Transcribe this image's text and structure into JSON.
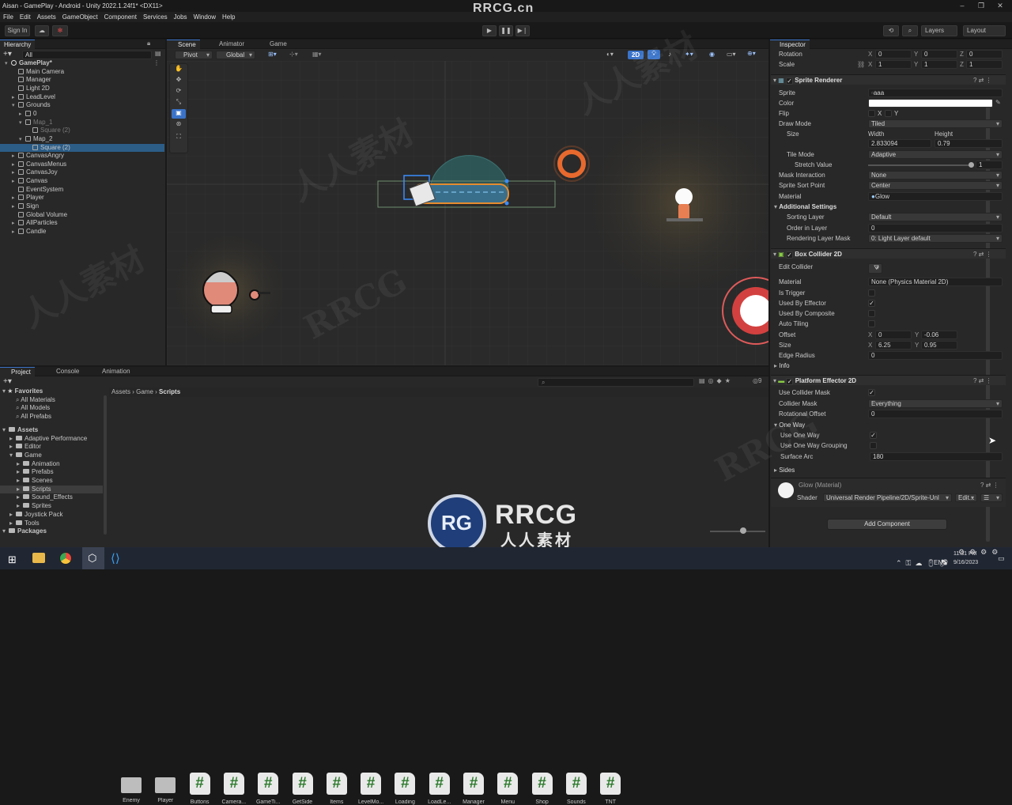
{
  "window": {
    "title": "Aisan - GamePlay - Android - Unity 2022.1.24f1* <DX11>",
    "watermark_top": "RRCG.cn"
  },
  "menu": [
    "File",
    "Edit",
    "Assets",
    "GameObject",
    "Component",
    "Services",
    "Jobs",
    "Window",
    "Help"
  ],
  "toolbar": {
    "sign_in": "Sign In",
    "layers": "Layers",
    "layout": "Layout"
  },
  "hierarchy": {
    "tab": "Hierarchy",
    "search": "All",
    "rows": [
      {
        "label": "GamePlay*",
        "indent": 0,
        "expanded": true,
        "scene": true
      },
      {
        "label": "Main Camera",
        "indent": 1
      },
      {
        "label": "Manager",
        "indent": 1
      },
      {
        "label": "Light 2D",
        "indent": 1
      },
      {
        "label": "LeadLevel",
        "indent": 1,
        "arrow": true
      },
      {
        "label": "Grounds",
        "indent": 1,
        "expanded": true
      },
      {
        "label": "0",
        "indent": 2,
        "arrow": true
      },
      {
        "label": "Map_1",
        "indent": 2,
        "expanded": true,
        "dim": true
      },
      {
        "label": "Square (2)",
        "indent": 3,
        "dim": true
      },
      {
        "label": "Map_2",
        "indent": 2,
        "expanded": true
      },
      {
        "label": "Square (2)",
        "indent": 3,
        "selected": true
      },
      {
        "label": "CanvasAngry",
        "indent": 1,
        "arrow": true
      },
      {
        "label": "CanvasMenus",
        "indent": 1,
        "arrow": true
      },
      {
        "label": "CanvasJoy",
        "indent": 1,
        "arrow": true
      },
      {
        "label": "Canvas",
        "indent": 1,
        "arrow": true
      },
      {
        "label": "EventSystem",
        "indent": 1
      },
      {
        "label": "Player",
        "indent": 1,
        "arrow": true
      },
      {
        "label": "Sign",
        "indent": 1,
        "arrow": true
      },
      {
        "label": "Global Volume",
        "indent": 1
      },
      {
        "label": "AllParticles",
        "indent": 1,
        "arrow": true
      },
      {
        "label": "Candle",
        "indent": 1,
        "arrow": true
      }
    ]
  },
  "scene": {
    "tabs": [
      "Scene",
      "Animator",
      "Game"
    ],
    "pivot": "Pivot",
    "global": "Global",
    "mode2d": "2D"
  },
  "project": {
    "tabs": [
      "Project",
      "Console",
      "Animation"
    ],
    "breadcrumb": [
      "Assets",
      "Game",
      "Scripts"
    ],
    "count": "9",
    "favorites": {
      "label": "Favorites",
      "items": [
        "All Materials",
        "All Models",
        "All Prefabs"
      ]
    },
    "tree": [
      {
        "label": "Assets",
        "indent": 0,
        "bold": true
      },
      {
        "label": "Adaptive Performance",
        "indent": 1
      },
      {
        "label": "Editor",
        "indent": 1
      },
      {
        "label": "Game",
        "indent": 1
      },
      {
        "label": "Animation",
        "indent": 2
      },
      {
        "label": "Prefabs",
        "indent": 2
      },
      {
        "label": "Scenes",
        "indent": 2
      },
      {
        "label": "Scripts",
        "indent": 2,
        "selected": true
      },
      {
        "label": "Sound_Effects",
        "indent": 2
      },
      {
        "label": "Sprites",
        "indent": 2
      },
      {
        "label": "Joystick Pack",
        "indent": 1
      },
      {
        "label": "Tools",
        "indent": 1
      },
      {
        "label": "Packages",
        "indent": 0,
        "bold": true
      }
    ],
    "assets": [
      {
        "name": "Enemy",
        "type": "folder"
      },
      {
        "name": "Player",
        "type": "folder"
      },
      {
        "name": "Buttons",
        "type": "script"
      },
      {
        "name": "Camera...",
        "type": "script"
      },
      {
        "name": "GameTi...",
        "type": "script"
      },
      {
        "name": "GetSide",
        "type": "script"
      },
      {
        "name": "Items",
        "type": "script"
      },
      {
        "name": "LevelMo...",
        "type": "script"
      },
      {
        "name": "Loading",
        "type": "script"
      },
      {
        "name": "LoadLe...",
        "type": "script"
      },
      {
        "name": "Manager",
        "type": "script"
      },
      {
        "name": "Menu",
        "type": "script"
      },
      {
        "name": "Shop",
        "type": "script"
      },
      {
        "name": "Sounds",
        "type": "script"
      },
      {
        "name": "TNT",
        "type": "script"
      }
    ]
  },
  "inspector": {
    "tab": "Inspector",
    "transform": {
      "rotation": {
        "label": "Rotation",
        "x": "0",
        "y": "0",
        "z": "0"
      },
      "scale": {
        "label": "Scale",
        "x": "1",
        "y": "1",
        "z": "1"
      }
    },
    "sprite_renderer": {
      "title": "Sprite Renderer",
      "sprite_label": "Sprite",
      "sprite": "aaa",
      "color_label": "Color",
      "flip_label": "Flip",
      "flip_x": "X",
      "flip_y": "Y",
      "draw_mode_label": "Draw Mode",
      "draw_mode": "Tiled",
      "size_label": "Size",
      "width_label": "Width",
      "height_label": "Height",
      "width": "2.833094",
      "height": "0.79",
      "tile_mode_label": "Tile Mode",
      "tile_mode": "Adaptive",
      "stretch_label": "Stretch Value",
      "stretch": "1",
      "mask_label": "Mask Interaction",
      "mask": "None",
      "sort_point_label": "Sprite Sort Point",
      "sort_point": "Center",
      "material_label": "Material",
      "material": "Glow",
      "additional": "Additional Settings",
      "sorting_layer_label": "Sorting Layer",
      "sorting_layer": "Default",
      "order_label": "Order in Layer",
      "order": "0",
      "rlm_label": "Rendering Layer Mask",
      "rlm": "0: Light Layer default"
    },
    "box_collider": {
      "title": "Box Collider 2D",
      "edit_label": "Edit Collider",
      "material_label": "Material",
      "material": "None (Physics Material 2D)",
      "is_trigger": "Is Trigger",
      "used_by_effector": "Used By Effector",
      "used_by_composite": "Used By Composite",
      "auto_tiling": "Auto Tiling",
      "offset_label": "Offset",
      "offset_x": "0",
      "offset_y": "-0.06",
      "size_label": "Size",
      "size_x": "6.25",
      "size_y": "0.95",
      "edge_label": "Edge Radius",
      "edge": "0",
      "info": "Info"
    },
    "platform_effector": {
      "title": "Platform Effector 2D",
      "use_mask": "Use Collider Mask",
      "mask_label": "Collider Mask",
      "mask": "Everything",
      "rot_label": "Rotational Offset",
      "rot": "0",
      "one_way": "One Way",
      "use_one_way": "Use One Way",
      "grouping": "Use One Way Grouping",
      "arc_label": "Surface Arc",
      "arc": "180",
      "sides": "Sides"
    },
    "material": {
      "name": "Glow (Material)",
      "shader_label": "Shader",
      "shader": "Universal Render Pipeline/2D/Sprite-Unl",
      "edit": "Edit..."
    },
    "add_component": "Add Component"
  },
  "taskbar": {
    "lang": "ENG",
    "time": "11:31 PM",
    "date": "9/16/2023"
  },
  "watermark": {
    "brand": "RRCG",
    "sub": "人人素材",
    "repeat": "人人素材",
    "repeat2": "RRCG"
  },
  "colors": {
    "accent": "#3a73c8",
    "selection": "#2c5d87",
    "script_hash": "#2d7a2d"
  }
}
